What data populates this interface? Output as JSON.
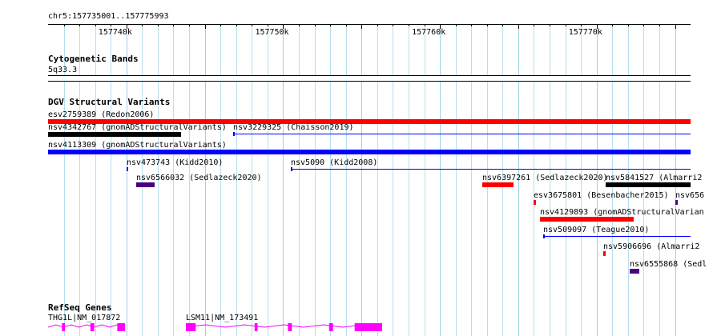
{
  "ruler": {
    "region": "chr5:157735001..157775993",
    "start": 157735001,
    "end": 157775993,
    "tick_labels": [
      "157740k",
      "157750k",
      "157760k",
      "157770k"
    ]
  },
  "tracks": {
    "cytoband": {
      "title": "Cytogenetic Bands",
      "band": "5q33.3"
    },
    "dgv": {
      "title": "DGV Structural Variants",
      "features": [
        {
          "label": "esv2759389 (Redon2006)",
          "start": 157735001,
          "end": 157775993,
          "color": "#ff0000",
          "thick": true
        },
        {
          "label": "nsv4342767 (gnomADStructuralVariants)",
          "start": 157735001,
          "end": 157743500,
          "color": "#000000",
          "thick": true
        },
        {
          "label": "nsv3229325 (Chaisson2019)",
          "start": 157746800,
          "end": 157775993,
          "color": "#0000ff",
          "thick": false
        },
        {
          "label": "nsv4113309 (gnomADStructuralVariants)",
          "start": 157735001,
          "end": 157775993,
          "color": "#0000ff",
          "thick": true
        },
        {
          "label": "nsv473743 (Kidd2010)",
          "start": 157740000,
          "end": 157740100,
          "color": "#0000ff",
          "thick": false
        },
        {
          "label": "nsv5090 (Kidd2008)",
          "start": 157750500,
          "end": 157775993,
          "color": "#0000ff",
          "thick": false
        },
        {
          "label": "nsv6566032 (Sedlazeck2020)",
          "start": 157740600,
          "end": 157741800,
          "color": "#4b0082",
          "thick": true
        },
        {
          "label": "nsv6397261 (Sedlazeck2020)",
          "start": 157762700,
          "end": 157764700,
          "color": "#ff0000",
          "thick": true
        },
        {
          "label": "nsv5841527 (Almarri2",
          "start": 157770600,
          "end": 157775993,
          "color": "#000000",
          "thick": true
        },
        {
          "label": "esv3675801 (Besenbacher2015)",
          "start": 157766000,
          "end": 157766150,
          "color": "#ff0000",
          "thick": true
        },
        {
          "label": "nsv656",
          "start": 157775000,
          "end": 157775150,
          "color": "#4b0082",
          "thick": true
        },
        {
          "label": "nsv4129893 (gnomADStructuralVarian",
          "start": 157766400,
          "end": 157772400,
          "color": "#ff0000",
          "thick": true
        },
        {
          "label": "nsv509097 (Teague2010)",
          "start": 157766600,
          "end": 157775993,
          "color": "#0000ff",
          "thick": false
        },
        {
          "label": "nsv5906696 (Almarri2",
          "start": 157770400,
          "end": 157770550,
          "color": "#ff0000",
          "thick": true
        },
        {
          "label": "nsv6555868 (Sedl",
          "start": 157772100,
          "end": 157772700,
          "color": "#4b0082",
          "thick": true
        }
      ]
    },
    "refseq": {
      "title": "RefSeq Genes",
      "genes": [
        {
          "label": "THG1L|NM_017872",
          "start": 157735001,
          "end": 157739900,
          "color": "#ff00ff"
        },
        {
          "label": "LSM11|NM_173491",
          "start": 157743800,
          "end": 157756300,
          "color": "#ff00ff"
        }
      ]
    }
  }
}
